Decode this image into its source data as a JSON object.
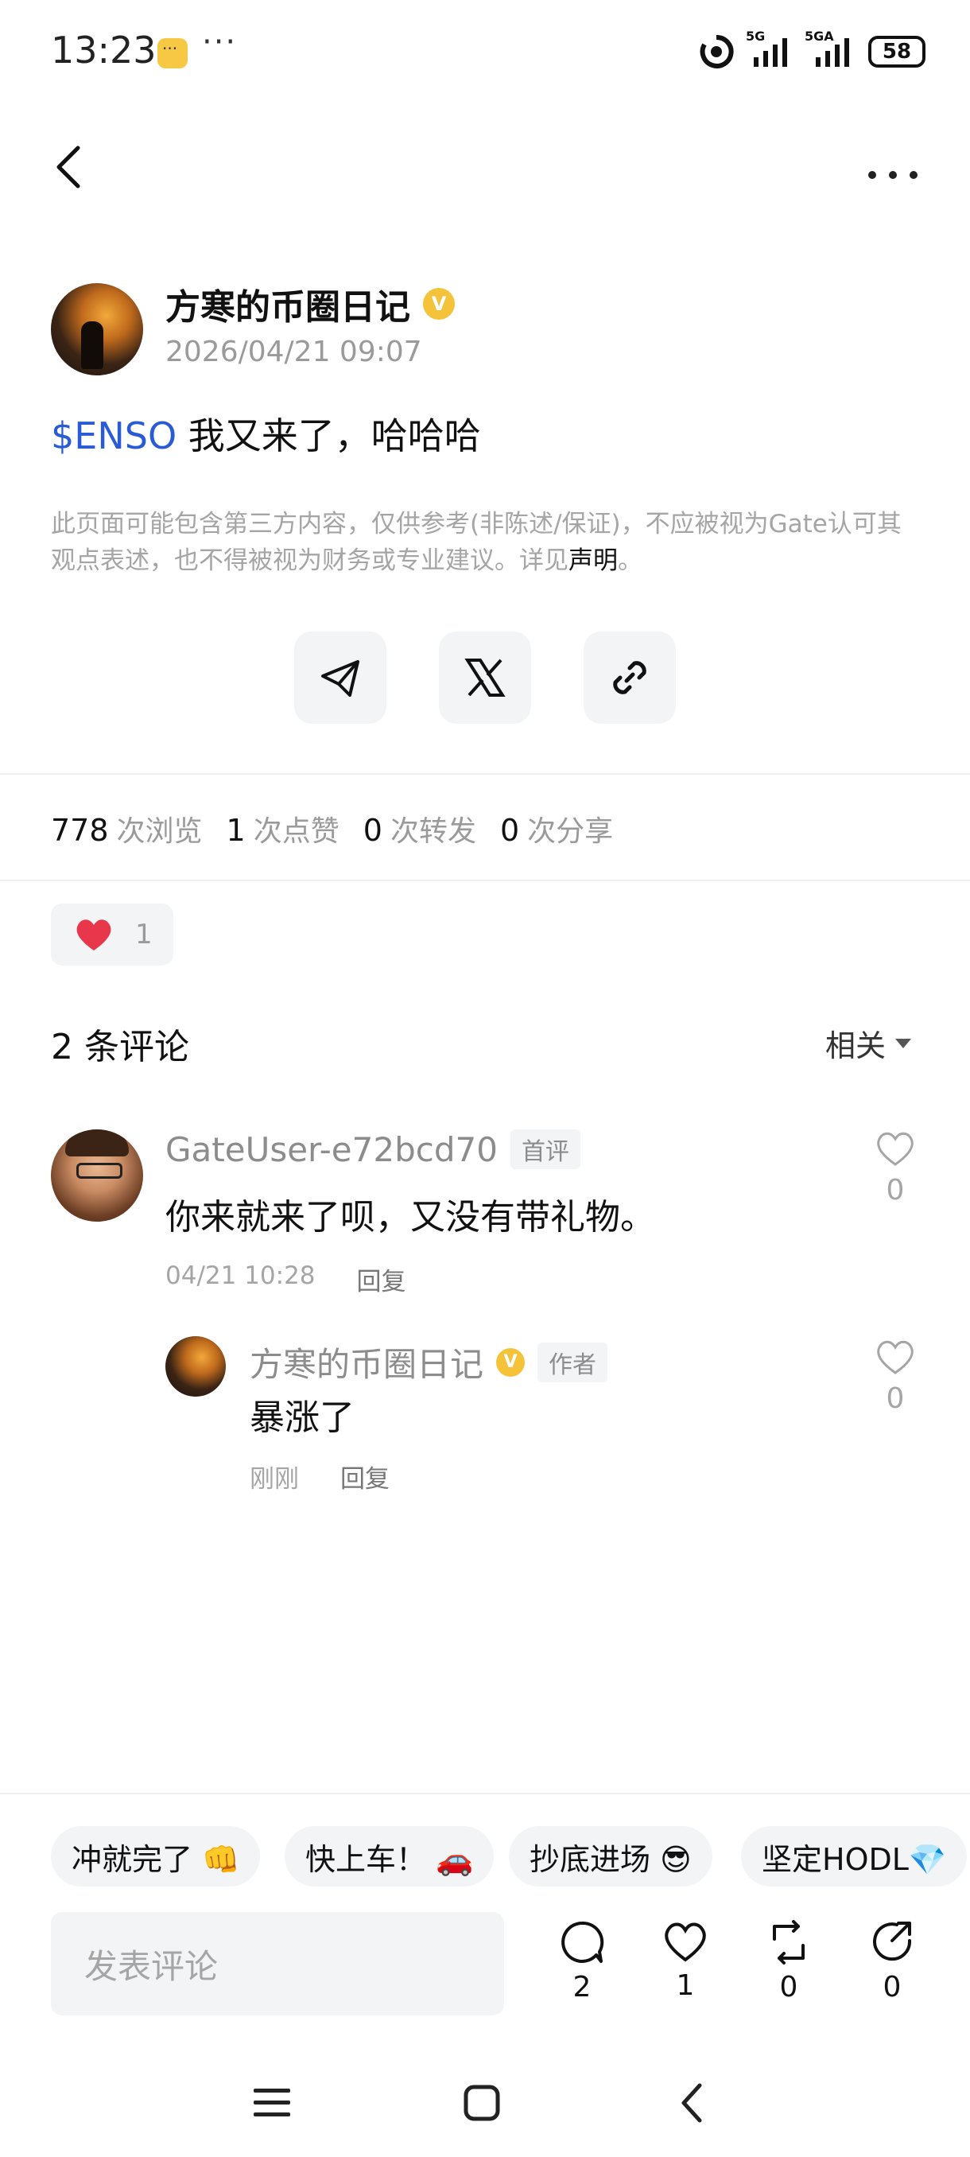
{
  "status_bar": {
    "time": "13:23",
    "dots": "···",
    "signal1": "5G",
    "signal2": "5GA",
    "battery": "58"
  },
  "post": {
    "author": "方寒的币圈日记",
    "verified_mark": "V",
    "date": "2026/04/21 09:07",
    "ticker": "$ENSO",
    "text": " 我又来了，哈哈哈",
    "disclaimer": "此页面可能包含第三方内容，仅供参考(非陈述/保证)，不应被视为Gate认可其观点表述，也不得被视为财务或专业建议。详见",
    "disclaimer_link": "声明",
    "disclaimer_end": "。"
  },
  "stats": {
    "views_count": "778",
    "views_label": "次浏览",
    "likes_count": "1",
    "likes_label": "次点赞",
    "reposts_count": "0",
    "reposts_label": "次转发",
    "shares_count": "0",
    "shares_label": "次分享"
  },
  "reaction": {
    "count": "1"
  },
  "comments": {
    "title": "2 条评论",
    "sort_label": "相关",
    "items": [
      {
        "user": "GateUser-e72bcd70",
        "tag": "首评",
        "text": "你来就来了呗，又没有带礼物。",
        "time": "04/21 10:28",
        "reply_label": "回复",
        "likes": "0"
      }
    ],
    "reply": {
      "user": "方寒的币圈日记",
      "verified_mark": "V",
      "tag": "作者",
      "text": "暴涨了",
      "time": "刚刚",
      "reply_label": "回复",
      "likes": "0"
    }
  },
  "quick_replies": [
    "冲就完了 👊",
    "快上车！ 🚗",
    "抄底进场 😎",
    "坚定HODL💎"
  ],
  "composer": {
    "placeholder": "发表评论"
  },
  "actions": {
    "comments": "2",
    "likes": "1",
    "reposts": "0",
    "shares": "0"
  },
  "colors": {
    "accent_blue": "#2a5bd7",
    "verified_gold": "#f4c33a",
    "heart_red": "#e8374a"
  }
}
